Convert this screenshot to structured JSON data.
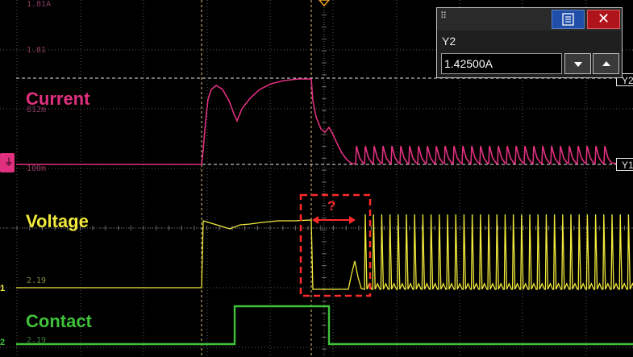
{
  "labels": {
    "current": "Current",
    "voltage": "Voltage",
    "contact": "Contact",
    "question": "?"
  },
  "scale_texts": {
    "top": "1.81A",
    "s1": "1.81",
    "s2": "812m",
    "s3": "100m",
    "s4": "2.19",
    "s5": "2.19"
  },
  "cursor_dialog": {
    "title": "Y2",
    "value": "1.42500A",
    "grip_icon": "drag-grip-icon",
    "menu_icon": "menu-list-icon",
    "close_icon": "close-icon",
    "down_icon": "triangle-down-icon",
    "up_icon": "triangle-up-icon"
  },
  "cursor_tags": {
    "y2": "Y2",
    "y1": "Y1"
  },
  "channel_markers": {
    "ch1": "1",
    "ch2": "2"
  },
  "colors": {
    "current": "#e0307f",
    "voltage": "#f2ea3c",
    "contact": "#3fc23a",
    "cursor_x": "#e6c77e",
    "annotation": "#ff2a2a",
    "grid": "#5a5a5a"
  }
}
